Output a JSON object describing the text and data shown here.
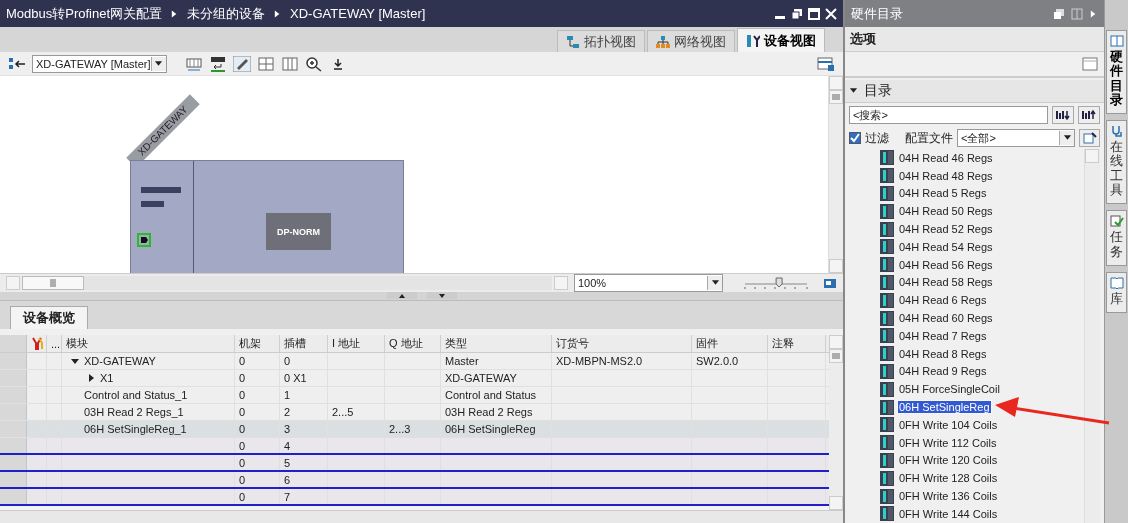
{
  "breadcrumb": [
    "Modbus转Profinet网关配置",
    "未分组的设备",
    "XD-GATEWAY [Master]"
  ],
  "view_tabs": [
    {
      "label": "拓扑视图",
      "kind": "topology",
      "selected": false
    },
    {
      "label": "网络视图",
      "kind": "network",
      "selected": false
    },
    {
      "label": "设备视图",
      "kind": "device",
      "selected": true
    }
  ],
  "toolbar": {
    "device_select": "XD-GATEWAY [Master]"
  },
  "canvas": {
    "device_label": "XD-GATEWAY",
    "module_label": "DP-NORM",
    "zoom": "100%",
    "zoom_slider": {
      "level": 0.55
    }
  },
  "overview": {
    "tab": "设备概览",
    "columns": [
      "...",
      "模块",
      "机架",
      "插槽",
      "I 地址",
      "Q 地址",
      "类型",
      "订货号",
      "固件",
      "注释"
    ],
    "rows": [
      {
        "module": "XD-GATEWAY",
        "expanded": true,
        "rack": "0",
        "slot": "0",
        "type": "Master",
        "order_number": "XD-MBPN-MS2.0",
        "firmware": "SW2.0.0",
        "selected": false,
        "kind": "module",
        "children": [
          {
            "module": "X1",
            "expanded": false,
            "rack": "0",
            "slot": "0 X1",
            "type": "XD-GATEWAY",
            "selected": false,
            "kind": "module"
          }
        ]
      },
      {
        "module": "Control and Status_1",
        "rack": "0",
        "slot": "1",
        "type": "Control and Status",
        "selected": false,
        "kind": "module"
      },
      {
        "module": "03H Read 2 Regs_1",
        "rack": "0",
        "slot": "2",
        "i_address": "2...5",
        "type": "03H Read 2 Regs",
        "selected": false,
        "kind": "module"
      },
      {
        "module": "06H SetSingleReg_1",
        "rack": "0",
        "slot": "3",
        "q_address": "2...3",
        "type": "06H SetSingleReg",
        "selected": true,
        "kind": "module"
      },
      {
        "rack": "0",
        "slot": "4",
        "selected": false,
        "kind": "empty"
      },
      {
        "rack": "0",
        "slot": "5",
        "selected": false,
        "kind": "empty"
      },
      {
        "rack": "0",
        "slot": "6",
        "selected": false,
        "kind": "empty"
      },
      {
        "rack": "0",
        "slot": "7",
        "selected": false,
        "kind": "empty"
      }
    ]
  },
  "catalog": {
    "title": "硬件目录",
    "options": "选项",
    "section": "目录",
    "expanded": true,
    "search_placeholder": "<搜索>",
    "filter": {
      "label": "过滤",
      "checked": true
    },
    "profile_label": "配置文件",
    "profile_value": "<全部>",
    "items": [
      {
        "label": "04H Read 46 Regs",
        "selected": false
      },
      {
        "label": "04H Read 48 Regs",
        "selected": false
      },
      {
        "label": "04H Read 5 Regs",
        "selected": false
      },
      {
        "label": "04H Read 50 Regs",
        "selected": false
      },
      {
        "label": "04H Read 52 Regs",
        "selected": false
      },
      {
        "label": "04H Read 54 Regs",
        "selected": false
      },
      {
        "label": "04H Read 56 Regs",
        "selected": false
      },
      {
        "label": "04H Read 58 Regs",
        "selected": false
      },
      {
        "label": "04H Read 6 Regs",
        "selected": false
      },
      {
        "label": "04H Read 60 Regs",
        "selected": false
      },
      {
        "label": "04H Read 7 Regs",
        "selected": false
      },
      {
        "label": "04H Read 8 Regs",
        "selected": false
      },
      {
        "label": "04H Read 9 Regs",
        "selected": false
      },
      {
        "label": "05H ForceSingleCoil",
        "selected": false
      },
      {
        "label": "06H SetSingleReg",
        "selected": true
      },
      {
        "label": "0FH Write 104 Coils",
        "selected": false
      },
      {
        "label": "0FH Write 112 Coils",
        "selected": false
      },
      {
        "label": "0FH Write 120 Coils",
        "selected": false
      },
      {
        "label": "0FH Write 128 Coils",
        "selected": false
      },
      {
        "label": "0FH Write 136 Coils",
        "selected": false
      },
      {
        "label": "0FH Write 144 Coils",
        "selected": false
      }
    ]
  },
  "side_tabs": [
    {
      "label": "硬件目录",
      "kind": "catalog"
    },
    {
      "label": "在线工具",
      "kind": "online"
    },
    {
      "label": "任务",
      "kind": "tasks"
    },
    {
      "label": "库",
      "kind": "library"
    }
  ]
}
